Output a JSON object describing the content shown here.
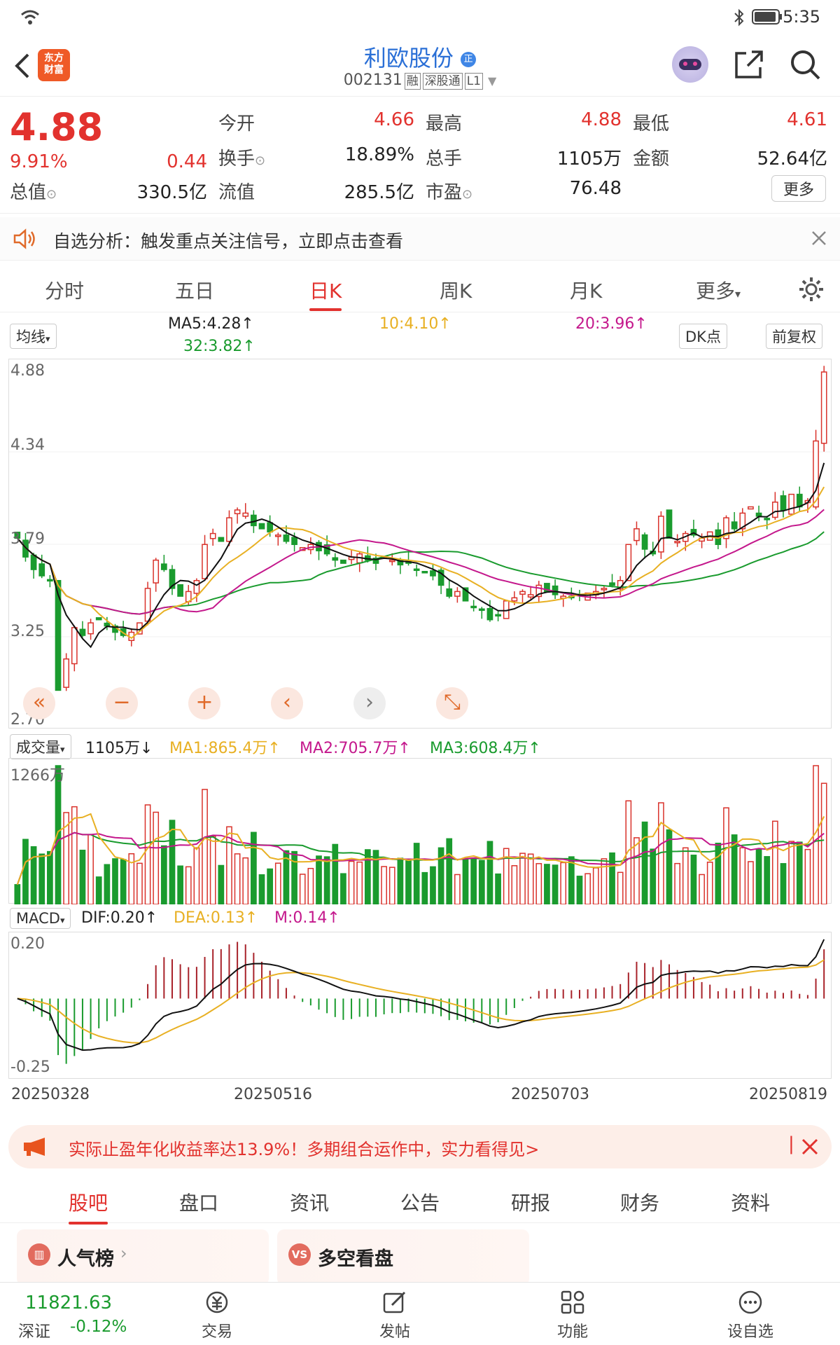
{
  "status": {
    "time": "5:35"
  },
  "header": {
    "title": "利欧股份",
    "code": "002131",
    "tags": [
      "融",
      "深股通",
      "L1"
    ]
  },
  "quote": {
    "price": "4.88",
    "change_pct": "9.91%",
    "change": "0.44",
    "fields": [
      {
        "label": "今开",
        "value": "4.66",
        "color": "red"
      },
      {
        "label": "最高",
        "value": "4.88",
        "color": "red"
      },
      {
        "label": "最低",
        "value": "4.61",
        "color": "red"
      },
      {
        "label": "换手",
        "value": "18.89%",
        "color": "normal"
      },
      {
        "label": "总手",
        "value": "1105万",
        "color": "normal"
      },
      {
        "label": "金额",
        "value": "52.64亿",
        "color": "normal"
      },
      {
        "label": "总值",
        "value": "330.5亿",
        "color": "normal"
      },
      {
        "label": "流值",
        "value": "285.5亿",
        "color": "normal"
      },
      {
        "label": "市盈",
        "value": "76.48",
        "color": "normal"
      }
    ],
    "more": "更多"
  },
  "notice": {
    "text": "自选分析：触发重点关注信号，立即点击查看"
  },
  "ktabs": [
    "分时",
    "五日",
    "日K",
    "周K",
    "月K",
    "更多"
  ],
  "ktab_active": "日K",
  "ma_bar": {
    "selector": "均线",
    "ma5": "MA5:4.28↑",
    "ma10": "10:4.10↑",
    "ma20": "20:3.96↑",
    "ma32": "32:3.82↑",
    "dk": "DK点",
    "fq": "前复权"
  },
  "price_axis": [
    "4.88",
    "4.34",
    "3.79",
    "3.25",
    "2.70"
  ],
  "volume_bar": {
    "selector": "成交量",
    "vol": "1105万↓",
    "ma1": "MA1:865.4万↑",
    "ma2": "MA2:705.7万↑",
    "ma3": "MA3:608.4万↑",
    "max_label": "1266万"
  },
  "macd_bar": {
    "selector": "MACD",
    "dif": "DIF:0.20↑",
    "dea": "DEA:0.13↑",
    "m": "M:0.14↑",
    "top": "0.20",
    "bottom": "-0.25"
  },
  "dates": [
    "20250328",
    "20250516",
    "20250703",
    "20250819"
  ],
  "chart_data": {
    "type": "candlestick",
    "ylim": [
      2.7,
      4.88
    ],
    "close": [
      3.82,
      3.7,
      3.62,
      3.58,
      3.55,
      2.85,
      3.05,
      3.25,
      3.2,
      3.28,
      3.3,
      3.26,
      3.22,
      3.2,
      3.22,
      3.28,
      3.5,
      3.68,
      3.62,
      3.5,
      3.45,
      3.48,
      3.55,
      3.78,
      3.85,
      3.8,
      3.95,
      4.0,
      3.98,
      3.9,
      3.88,
      3.86,
      3.84,
      3.8,
      3.78,
      3.76,
      3.78,
      3.74,
      3.72,
      3.68,
      3.66,
      3.7,
      3.72,
      3.68,
      3.66,
      3.7,
      3.68,
      3.65,
      3.66,
      3.62,
      3.6,
      3.58,
      3.52,
      3.45,
      3.48,
      3.42,
      3.38,
      3.36,
      3.3,
      3.33,
      3.42,
      3.44,
      3.48,
      3.46,
      3.52,
      3.48,
      3.46,
      3.45,
      3.44,
      3.46,
      3.47,
      3.48,
      3.5,
      3.52,
      3.55,
      3.78,
      3.88,
      3.75,
      3.72,
      3.96,
      3.82,
      3.8,
      3.85,
      3.84,
      3.82,
      3.86,
      3.78,
      3.95,
      3.88,
      3.98,
      4.02,
      3.96,
      3.94,
      4.05,
      4.0,
      4.1,
      4.02,
      4.06,
      4.44,
      4.88
    ],
    "volume_max_wan": 1266,
    "volume_latest_wan": 1105,
    "macd": {
      "dif": 0.2,
      "dea": 0.13,
      "m": 0.14,
      "range": [
        -0.25,
        0.2
      ]
    }
  },
  "banner": {
    "text": "实际止盈年化收益率达13.9%！多期组合运作中，实力看得见>"
  },
  "btabs": [
    "股吧",
    "盘口",
    "资讯",
    "公告",
    "研报",
    "财务",
    "资料"
  ],
  "btab_active": "股吧",
  "cards": [
    "人气榜",
    "多空看盘"
  ],
  "bottom": {
    "index_value": "11821.63",
    "index_name": "深证",
    "index_change": "-0.12%",
    "nav": [
      "交易",
      "发帖",
      "功能",
      "设自选"
    ]
  }
}
